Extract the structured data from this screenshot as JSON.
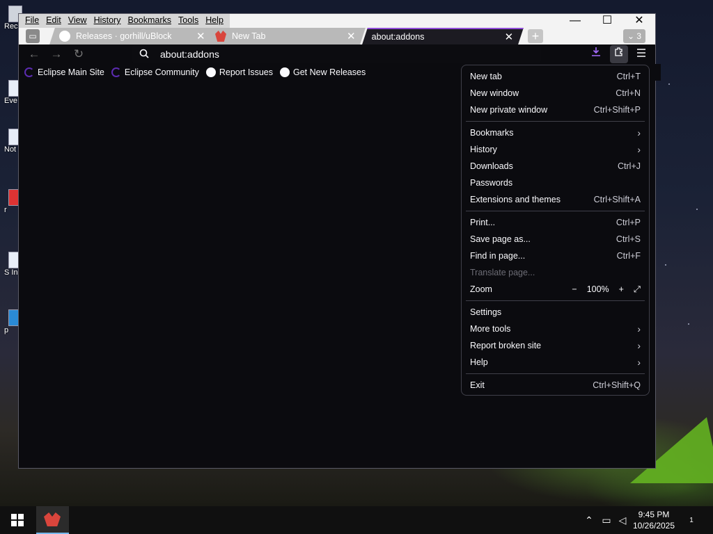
{
  "desktop": {
    "icons": [
      {
        "label": "Rec"
      },
      {
        "label": "Eve"
      },
      {
        "label": "Not"
      },
      {
        "label": "r"
      },
      {
        "label": "S In"
      },
      {
        "label": "p"
      }
    ]
  },
  "window": {
    "menu": [
      "File",
      "Edit",
      "View",
      "History",
      "Bookmarks",
      "Tools",
      "Help"
    ],
    "controls": {
      "minimize": "—",
      "maximize": "☐",
      "close": "✕"
    }
  },
  "tabs": [
    {
      "title": "Releases · gorhill/uBlock",
      "icon": "github-icon",
      "active": false
    },
    {
      "title": "New Tab",
      "icon": "browser-logo-icon",
      "active": false
    },
    {
      "title": "about:addons",
      "icon": "",
      "active": true
    }
  ],
  "tabstrip": {
    "new_tab": "+",
    "all_tabs_count": "3"
  },
  "navbar": {
    "back": "←",
    "forward": "→",
    "reload": "↻",
    "url": "about:addons"
  },
  "bookmarks": [
    {
      "label": "Eclipse Main Site",
      "icon": "eclipse-icon"
    },
    {
      "label": "Eclipse Community",
      "icon": "eclipse-icon"
    },
    {
      "label": "Report Issues",
      "icon": "github-icon"
    },
    {
      "label": "Get New Releases",
      "icon": "github-icon"
    }
  ],
  "app_menu": {
    "group1": [
      {
        "label": "New tab",
        "shortcut": "Ctrl+T"
      },
      {
        "label": "New window",
        "shortcut": "Ctrl+N"
      },
      {
        "label": "New private window",
        "shortcut": "Ctrl+Shift+P"
      }
    ],
    "group2": [
      {
        "label": "Bookmarks",
        "shortcut": "›"
      },
      {
        "label": "History",
        "shortcut": "›"
      },
      {
        "label": "Downloads",
        "shortcut": "Ctrl+J"
      },
      {
        "label": "Passwords",
        "shortcut": ""
      },
      {
        "label": "Extensions and themes",
        "shortcut": "Ctrl+Shift+A"
      }
    ],
    "group3": [
      {
        "label": "Print...",
        "shortcut": "Ctrl+P"
      },
      {
        "label": "Save page as...",
        "shortcut": "Ctrl+S"
      },
      {
        "label": "Find in page...",
        "shortcut": "Ctrl+F"
      },
      {
        "label": "Translate page...",
        "shortcut": "",
        "disabled": true
      }
    ],
    "zoom": {
      "label": "Zoom",
      "minus": "−",
      "value": "100%",
      "plus": "+",
      "fullscreen": "⤢"
    },
    "group4": [
      {
        "label": "Settings",
        "shortcut": ""
      },
      {
        "label": "More tools",
        "shortcut": "›"
      },
      {
        "label": "Report broken site",
        "shortcut": "›"
      },
      {
        "label": "Help",
        "shortcut": "›"
      }
    ],
    "group5": [
      {
        "label": "Exit",
        "shortcut": "Ctrl+Shift+Q"
      }
    ]
  },
  "taskbar": {
    "time": "9:45 PM",
    "date": "10/26/2025",
    "notifications": "1"
  },
  "colors": {
    "accent": "#8f4bd8",
    "download": "#a66cff"
  }
}
